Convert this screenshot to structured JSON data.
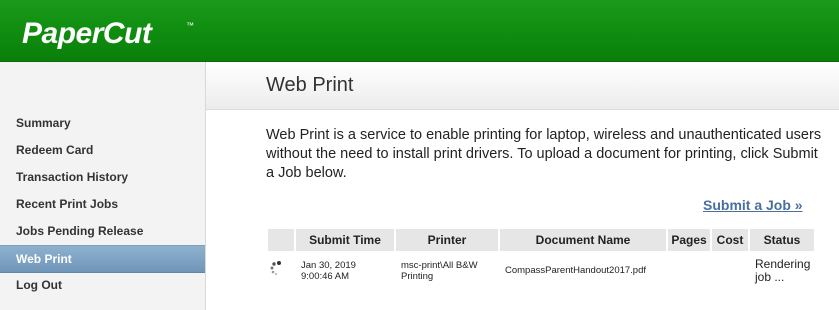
{
  "header": {
    "logo_text": "PaperCut",
    "trademark": "™",
    "bg_color": "#0f8c0f"
  },
  "sidebar": {
    "items": [
      {
        "label": "Summary"
      },
      {
        "label": "Redeem Card"
      },
      {
        "label": "Transaction History"
      },
      {
        "label": "Recent Print Jobs"
      },
      {
        "label": "Jobs Pending Release"
      },
      {
        "label": "Web Print",
        "active": true
      },
      {
        "label": "Log Out"
      }
    ]
  },
  "main": {
    "title": "Web Print",
    "description": "Web Print is a service to enable printing for laptop, wireless and unauthenticated users without the need to install print drivers. To upload a document for printing, click Submit a Job below.",
    "submit_link": "Submit a Job »",
    "table": {
      "columns": [
        "",
        "Submit Time",
        "Printer",
        "Document Name",
        "Pages",
        "Cost",
        "Status"
      ],
      "rows": [
        {
          "icon": "spinner-icon",
          "submit_time_line1": "Jan 30, 2019",
          "submit_time_line2": "9:00:46 AM",
          "printer_line1": "msc-print\\All B&W",
          "printer_line2": "Printing",
          "document_name": "CompassParentHandout2017.pdf",
          "pages": "",
          "cost": "",
          "status_line1": "Rendering",
          "status_line2": "job ..."
        }
      ]
    }
  },
  "colors": {
    "link": "#4a6f9f",
    "active_nav": "#7fa3c6"
  }
}
